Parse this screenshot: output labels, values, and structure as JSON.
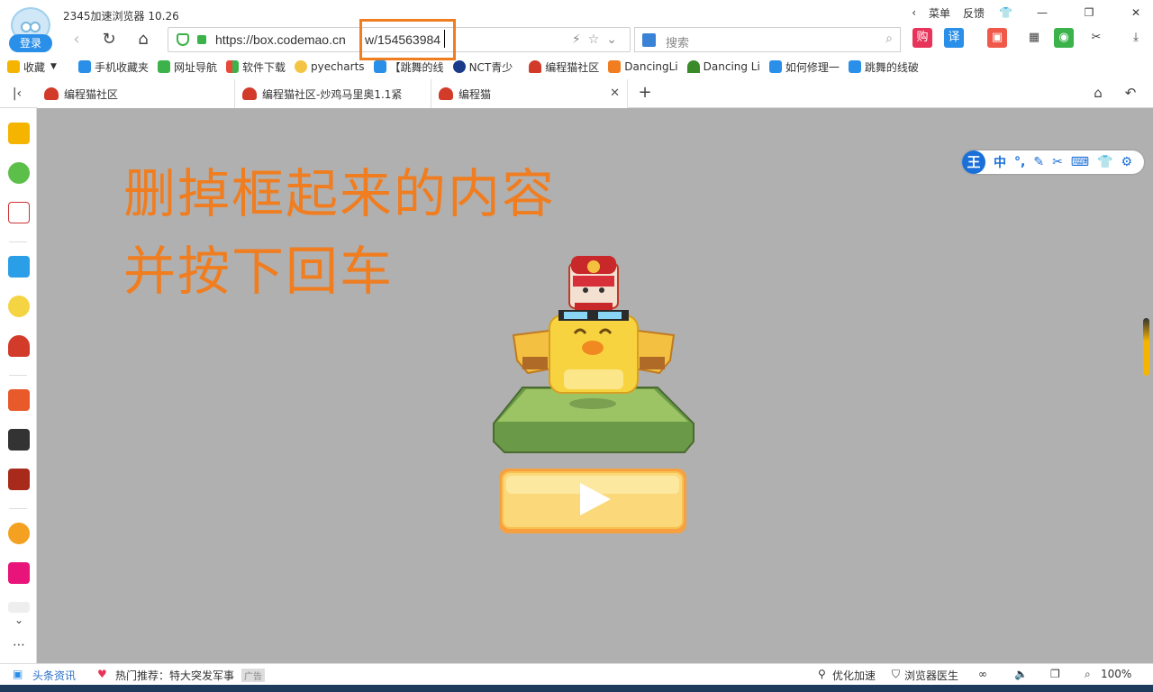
{
  "titlebar": {
    "title": "2345加速浏览器 10.26",
    "login": "登录",
    "menu": "菜单",
    "feedback": "反馈"
  },
  "nav": {
    "url_prefix": "https://box.codemao.cn",
    "url_selected": "w/154563984",
    "search_placeholder": "搜索",
    "ext_buy": "购",
    "ext_translate": "译"
  },
  "bookmarks": [
    {
      "label": "收藏",
      "color": "#f4b400"
    },
    {
      "label": "手机收藏夹",
      "color": "#2a8fe8"
    },
    {
      "label": "网址导航",
      "color": "#3bb34a"
    },
    {
      "label": "软件下载",
      "color": "#e84a3a"
    },
    {
      "label": "pyecharts",
      "color": "#f4c542"
    },
    {
      "label": "【跳舞的线",
      "color": "#2a8fe8"
    },
    {
      "label": "NCT青少",
      "color": "#1a3a8a"
    },
    {
      "label": "编程猫社区",
      "color": "#d23a2a"
    },
    {
      "label": "DancingLi",
      "color": "#f07d1f"
    },
    {
      "label": "Dancing Li",
      "color": "#3a8a2a"
    },
    {
      "label": "如何修理一",
      "color": "#2a8fe8"
    },
    {
      "label": "跳舞的线破",
      "color": "#2a8fe8"
    }
  ],
  "tabs": [
    {
      "label": "编程猫社区"
    },
    {
      "label": "编程猫社区-炒鸡马里奥1.1紧"
    },
    {
      "label": "编程猫"
    }
  ],
  "main": {
    "instruction_line1": "删掉框起来的内容",
    "instruction_line2": "并按下回车",
    "ime_items": [
      "中",
      "°,",
      "✎",
      "✂",
      "⌨",
      "👕",
      "⚙"
    ],
    "ime_logo": "王"
  },
  "statusbar": {
    "news": "头条资讯",
    "hot": "热门推荐：特大突发军事",
    "ad": "广告",
    "optimize": "优化加速",
    "doctor": "浏览器医生",
    "zoom": "100%"
  },
  "colors": {
    "accent": "#f07d1f",
    "content_bg": "#b0b0b0",
    "chick_yellow": "#f8d340",
    "platform_green": "#8cbc5c",
    "play_button": "#fbd97a"
  }
}
